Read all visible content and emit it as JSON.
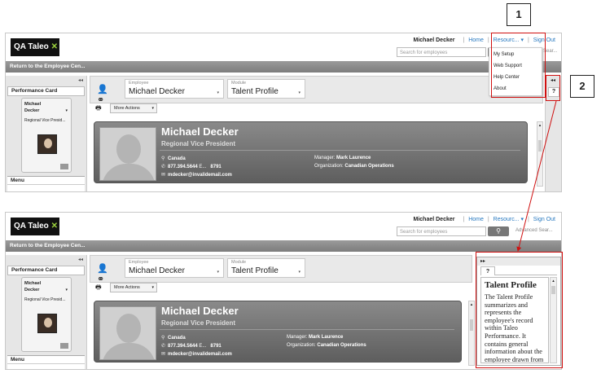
{
  "app": {
    "logo_text": "QA Taleo",
    "logo_mark": "✕"
  },
  "header": {
    "user_name": "Michael Decker",
    "home": "Home",
    "resources": "Resourc...",
    "resources_caret": "▾",
    "sign_out": "Sign Out",
    "separator": "|",
    "search_placeholder": "Search for employees",
    "advanced_search_short": "Sear...",
    "advanced_search": "Advanced Sear..."
  },
  "nav_bar": {
    "return_link": "Return to the Employee Cen..."
  },
  "resources_menu": {
    "items": [
      "My Setup",
      "Web Support",
      "Help Center",
      "About"
    ]
  },
  "left_panel": {
    "collapse": "◂◂",
    "title": "Performance Card",
    "card_name_line1": "Michael",
    "card_name_line2": "Decker",
    "card_title": "Regional Vice Presid...",
    "menu_label": "Menu"
  },
  "selectors": {
    "employee_label": "Employee",
    "employee_value": "Michael Decker",
    "module_label": "Module",
    "module_value": "Talent Profile",
    "more_actions": "More Actions"
  },
  "profile": {
    "name": "Michael Decker",
    "title": "Regional Vice President",
    "country": "Canada",
    "phone": "877.394.5644",
    "ext_label": "E...",
    "ext": "8791",
    "email": "mdecker@invalidemail.com",
    "manager_label": "Manager:",
    "manager": "Mark Laurence",
    "org_label": "Organization:",
    "org": "Canadian Operations"
  },
  "right_panel": {
    "expand": "◂◂",
    "help_icon": "?"
  },
  "help_panel": {
    "expand": "▸▸",
    "tab": "?",
    "heading": "Talent Profile",
    "body": "The Talent Profile summarizes and represents the employee's record within Taleo Performance. It contains general information about the employee drawn from"
  },
  "callouts": {
    "one": "1",
    "two": "2"
  },
  "colors": {
    "link": "#2a7ac0",
    "highlight": "#d01010",
    "logo_mark": "#9bd13d"
  }
}
